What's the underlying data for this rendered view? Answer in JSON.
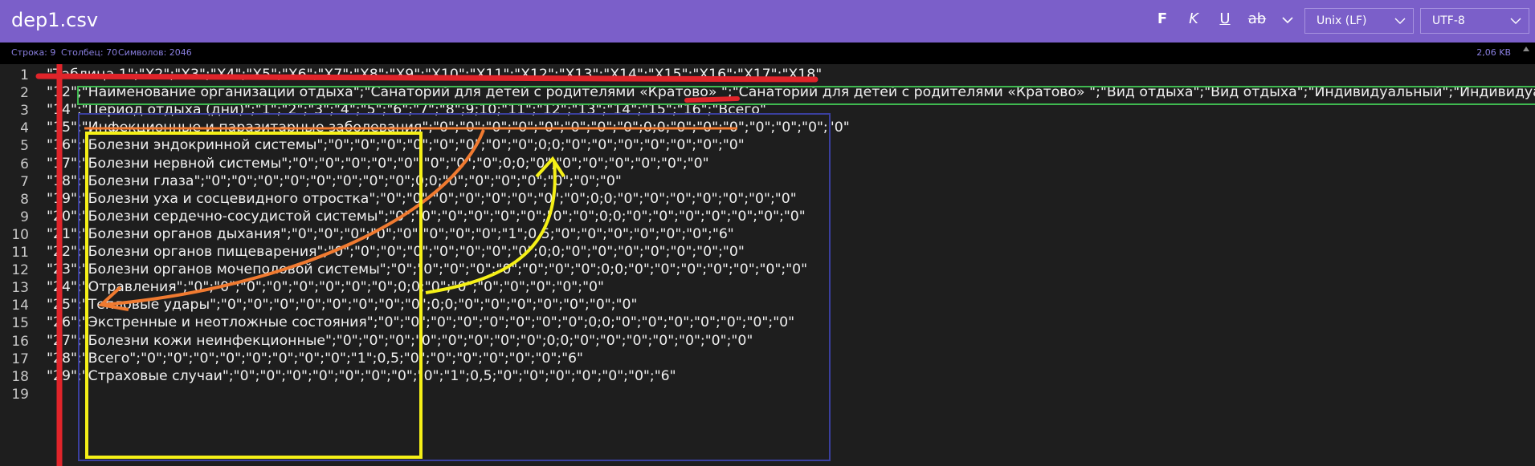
{
  "window": {
    "title": "dep1.csv"
  },
  "toolbar": {
    "bold": "F",
    "italic": "K",
    "underline": "U",
    "strike": "ab",
    "line_ending": "Unix (LF)",
    "encoding": "UTF-8"
  },
  "status": {
    "line": "Строка: 9",
    "column": "Столбец: 70",
    "chars": "Символов: 2046",
    "size": "2,06 KB"
  },
  "lines": [
    {
      "n": "1",
      "text": "\"Таблица.1\";\"X2\";\"X3\";\"X4\";\"X5\";\"X6\";\"X7\";\"X8\";\"X9\";\"X10\";\"X11\";\"X12\";\"X13\";\"X14\";\"X15\";\"X16\";\"X17\";\"X18\""
    },
    {
      "n": "2",
      "text": "\"12\";\"Наименование организации отдыха\";\"Санаторий для детей с родителями «Кратово» \";\"Санаторий для детей с родителями «Кратово» \";\"Вид отдыха\";\"Вид отдыха\";\"Индивидуальный\";\"Индивидуал"
    },
    {
      "n": "3",
      "text": "\"14\";\"Период отдыха (дни)\";\"1\";\"2\";\"3\";\"4\";\"5\";\"6\";\"7\";\"8\";9;10;\"11\";\"12\";\"13\";\"14\";\"15\";\"16\";\"Всего\""
    },
    {
      "n": "4",
      "text": "\"15\";\"Инфекционные и паразитарные заболевания\";\"0\";\"0\";\"0\";\"0\";\"0\";\"0\";\"0\";\"0\";0;0;\"0\";\"0\";\"0\";\"0\";\"0\";\"0\";\"0\""
    },
    {
      "n": "5",
      "text": "\"16\";\"Болезни эндокринной системы\";\"0\";\"0\";\"0\";\"0\";\"0\";\"0\";\"0\";\"0\";0;0;\"0\";\"0\";\"0\";\"0\";\"0\";\"0\";\"0\""
    },
    {
      "n": "6",
      "text": "\"17\";\"Болезни нервной системы\";\"0\";\"0\";\"0\";\"0\";\"0\";\"0\";\"0\";\"0\";0;0;\"0\";\"0\";\"0\";\"0\";\"0\";\"0\";\"0\""
    },
    {
      "n": "7",
      "text": "\"18\";\"Болезни глаза\";\"0\";\"0\";\"0\";\"0\";\"0\";\"0\";\"0\";\"0\";0;0;\"0\";\"0\";\"0\";\"0\";\"0\";\"0\";\"0\""
    },
    {
      "n": "8",
      "text": "\"19\";\"Болезни уха и сосцевидного отростка\";\"0\";\"0\";\"0\";\"0\";\"0\";\"0\";\"0\";\"0\";0;0;\"0\";\"0\";\"0\";\"0\";\"0\";\"0\";\"0\""
    },
    {
      "n": "9",
      "text": "\"20\";\"Болезни сердечно-сосудистой системы\";\"0\";\"0\";\"0\";\"0\";\"0\";\"0\";\"0\";\"0\";0;0;\"0\";\"0\";\"0\";\"0\";\"0\";\"0\";\"0\""
    },
    {
      "n": "10",
      "text": "\"21\";\"Болезни органов дыхания\";\"0\";\"0\";\"0\";\"0\";\"0\";\"0\";\"0\";\"0\";\"1\";0,5;\"0\";\"0\";\"0\";\"0\";\"0\";\"0\";\"6\""
    },
    {
      "n": "11",
      "text": "\"22\";\"Болезни органов пищеварения\";\"0\";\"0\";\"0\";\"0\";\"0\";\"0\";\"0\";\"0\";0;0;\"0\";\"0\";\"0\";\"0\";\"0\";\"0\";\"0\""
    },
    {
      "n": "12",
      "text": "\"23\";\"Болезни органов мочеполовой системы\";\"0\";\"0\";\"0\";\"0\";\"0\";\"0\";\"0\";\"0\";0;0;\"0\";\"0\";\"0\";\"0\";\"0\";\"0\";\"0\""
    },
    {
      "n": "13",
      "text": "\"24\";\"Отравления\";\"0\";\"0\";\"0\";\"0\";\"0\";\"0\";\"0\";\"0\";0;0;\"0\";\"0\";\"0\";\"0\";\"0\";\"0\";\"0\""
    },
    {
      "n": "14",
      "text": "\"25\";\"Тепловые удары\";\"0\";\"0\";\"0\";\"0\";\"0\";\"0\";\"0\";\"0\";0;0;\"0\";\"0\";\"0\";\"0\";\"0\";\"0\";\"0\""
    },
    {
      "n": "15",
      "text": "\"26\";\"Экстренные и неотложные состояния\";\"0\";\"0\";\"0\";\"0\";\"0\";\"0\";\"0\";\"0\";0;0;\"0\";\"0\";\"0\";\"0\";\"0\";\"0\";\"0\""
    },
    {
      "n": "16",
      "text": "\"27\";\"Болезни кожи неинфекционные\";\"0\";\"0\";\"0\";\"0\";\"0\";\"0\";\"0\";\"0\";0;0;\"0\";\"0\";\"0\";\"0\";\"0\";\"0\";\"0\""
    },
    {
      "n": "17",
      "text": "\"28\";\"Всего\";\"0\";\"0\";\"0\";\"0\";\"0\";\"0\";\"0\";\"0\";\"1\";0,5;\"0\";\"0\";\"0\";\"0\";\"0\";\"0\";\"6\""
    },
    {
      "n": "18",
      "text": "\"29\";\"Страховые случаи\";\"0\";\"0\";\"0\";\"0\";\"0\";\"0\";\"0\";\"0\";\"1\";0,5;\"0\";\"0\";\"0\";\"0\";\"0\";\"0\";\"6\""
    },
    {
      "n": "19",
      "text": ""
    }
  ],
  "colors": {
    "titlebar": "#7b5fc9",
    "editor_bg": "#1e1e1e",
    "mark_red": "#e0242a",
    "mark_orange": "#f07a30",
    "mark_yellow": "#f5f017",
    "mark_green": "#3fb950",
    "mark_blue": "#3a3f9e"
  }
}
